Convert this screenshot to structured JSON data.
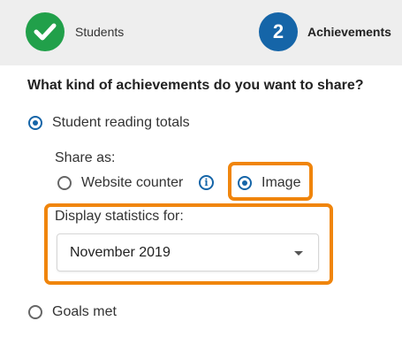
{
  "stepper": {
    "steps": [
      {
        "number": "",
        "label": "Students",
        "status": "complete",
        "color": "#21a04a"
      },
      {
        "number": "2",
        "label": "Achievements",
        "status": "current",
        "color": "#1565a8"
      }
    ]
  },
  "question": "What kind of achievements do you want to share?",
  "options": {
    "student_reading_totals": {
      "label": "Student reading totals",
      "checked": true
    },
    "goals_met": {
      "label": "Goals met",
      "checked": false
    }
  },
  "share_as": {
    "label": "Share as:",
    "website_counter": {
      "label": "Website counter",
      "checked": false
    },
    "image": {
      "label": "Image",
      "checked": true
    }
  },
  "display_statistics": {
    "label": "Display statistics for:",
    "selected": "November 2019"
  },
  "colors": {
    "accent": "#1565a8",
    "success": "#21a04a",
    "highlight": "#f0850c"
  },
  "icons": {
    "step1": "check-icon",
    "info": "info-icon",
    "dropdown": "chevron-down-icon"
  }
}
